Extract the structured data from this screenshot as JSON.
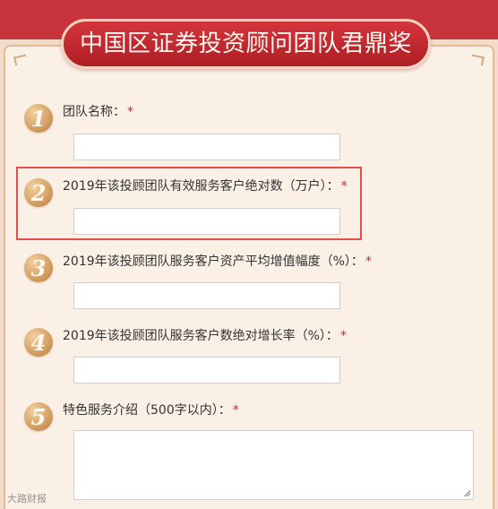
{
  "form": {
    "title": "中国区证券投资顾问团队君鼎奖",
    "fields": [
      {
        "number": "1",
        "label": "团队名称：",
        "required": "*",
        "value": ""
      },
      {
        "number": "2",
        "label": "2019年该投顾团队有效服务客户绝对数（万户）：",
        "required": "*",
        "value": ""
      },
      {
        "number": "3",
        "label": "2019年该投顾团队服务客户资产平均增值幅度（%）：",
        "required": "*",
        "value": ""
      },
      {
        "number": "4",
        "label": "2019年该投顾团队服务客户数绝对增长率（%）：",
        "required": "*",
        "value": ""
      },
      {
        "number": "5",
        "label": "特色服务介绍（500字以内）：",
        "required": "*",
        "value": ""
      }
    ]
  },
  "watermark": {
    "text": "大路财报"
  },
  "colors": {
    "banner_red": "#c8343b",
    "accent_gold": "#cd9558",
    "required_red": "#d7262b",
    "highlight_red": "#e34f4f"
  }
}
